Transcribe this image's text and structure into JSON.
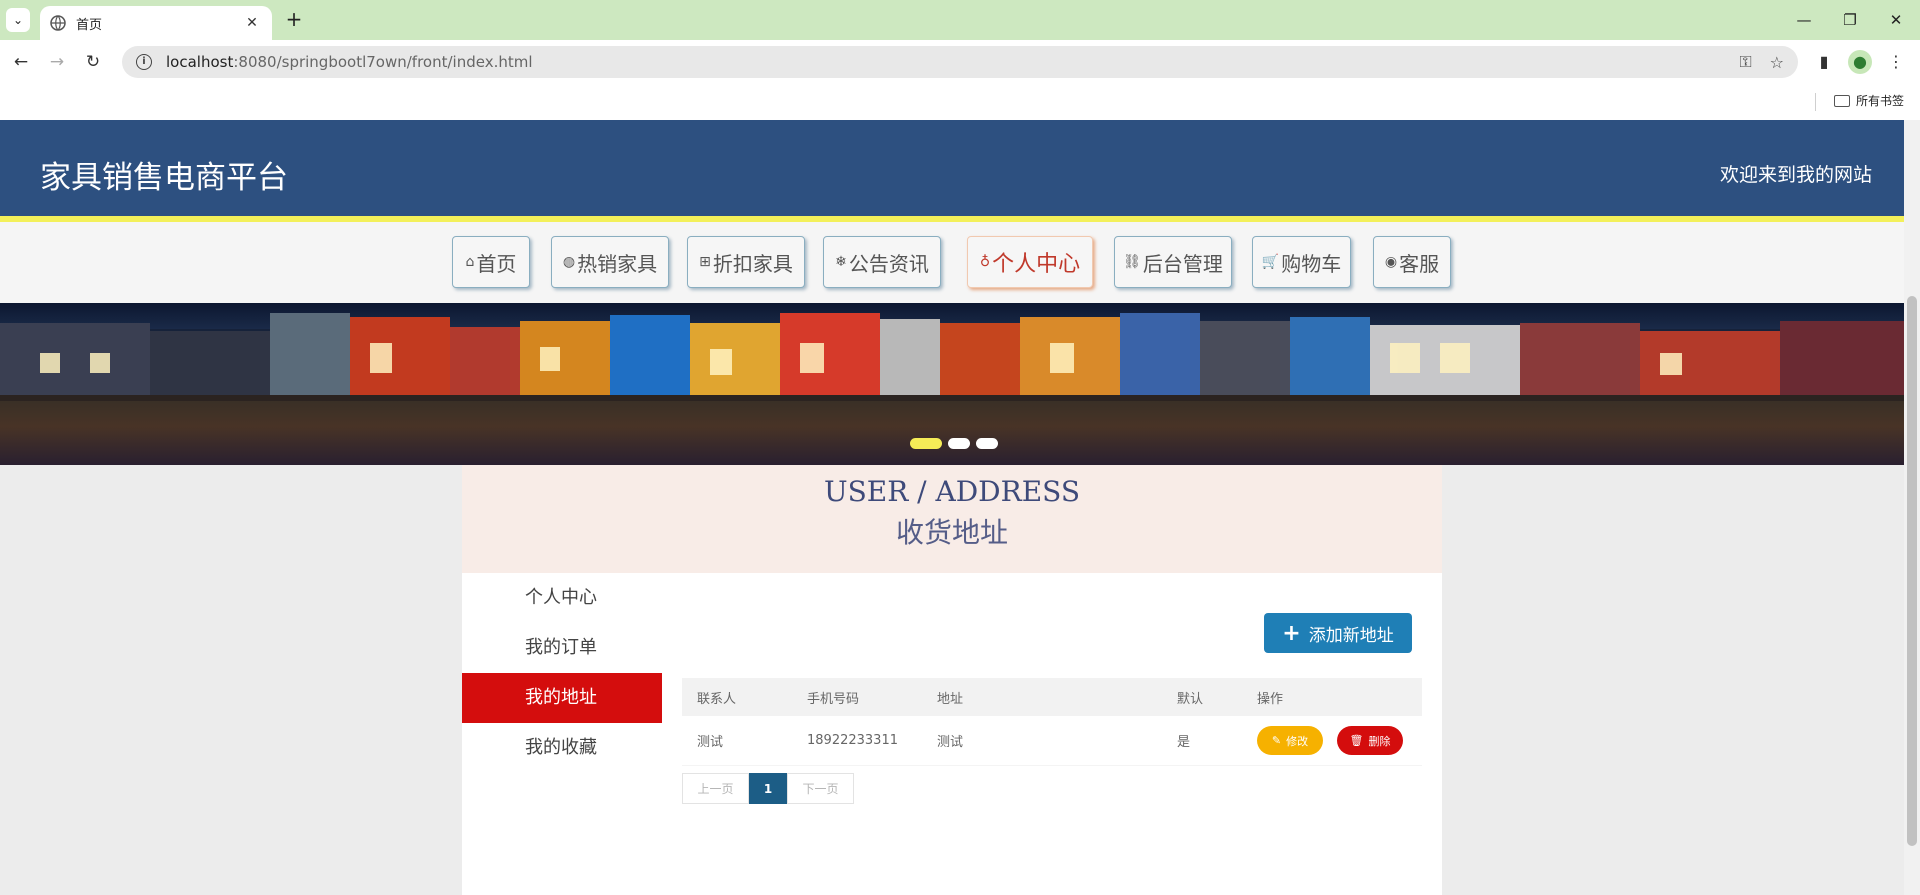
{
  "browser": {
    "tab_title": "首页",
    "url_host": "localhost",
    "url_rest": ":8080/springbootl7own/front/index.html",
    "bookmarks_label": "所有书签"
  },
  "site": {
    "title": "家具销售电商平台",
    "welcome": "欢迎来到我的网站",
    "accent_color": "#2d5080",
    "highlight_color": "#f3f05a"
  },
  "nav": {
    "items": [
      {
        "icon": "home-icon",
        "glyph": "⌂",
        "label": "首页"
      },
      {
        "icon": "globe-icon",
        "glyph": "◍",
        "label": "热销家具"
      },
      {
        "icon": "grid-icon",
        "glyph": "⊞",
        "label": "折扣家具"
      },
      {
        "icon": "snowflake-icon",
        "glyph": "❄",
        "label": "公告资讯"
      },
      {
        "icon": "user-icon",
        "glyph": "♁",
        "label": "个人中心"
      },
      {
        "icon": "link-icon",
        "glyph": "⛓",
        "label": "后台管理"
      },
      {
        "icon": "cart-icon",
        "glyph": "🛒",
        "label": "购物车"
      },
      {
        "icon": "support-icon",
        "glyph": "◉",
        "label": "客服"
      }
    ],
    "active_index": 4
  },
  "banner": {
    "slides": 3,
    "active_slide": 0
  },
  "section": {
    "title_en": "USER / ADDRESS",
    "title_zh": "收货地址"
  },
  "side_menu": {
    "items": [
      "个人中心",
      "我的订单",
      "我的地址",
      "我的收藏"
    ],
    "active_index": 2
  },
  "address": {
    "add_button": "添加新地址",
    "headers": [
      "联系人",
      "手机号码",
      "地址",
      "默认",
      "操作"
    ],
    "rows": [
      {
        "contact": "测试",
        "phone": "18922233311",
        "address": "测试",
        "default": "是",
        "edit": "修改",
        "delete": "删除"
      }
    ]
  },
  "pager": {
    "prev": "上一页",
    "current": "1",
    "next": "下一页"
  }
}
